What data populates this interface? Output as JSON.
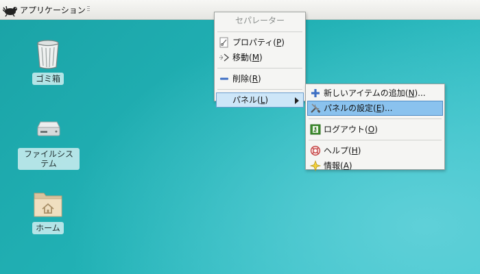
{
  "panel": {
    "app_menu_label": "アプリケーション",
    "logo_icon": "xfce-mouse-icon"
  },
  "desktop": {
    "icons": [
      {
        "label": "ゴミ箱",
        "icon": "trash-icon"
      },
      {
        "label": "ファイルシステム",
        "icon": "drive-icon"
      },
      {
        "label": "ホーム",
        "icon": "home-folder-icon"
      }
    ]
  },
  "context_menu": {
    "title": "セパレーター",
    "items": [
      {
        "label": "プロパティ(",
        "key": "P",
        "suffix": ")",
        "icon": "properties-icon"
      },
      {
        "label": "移動(",
        "key": "M",
        "suffix": ")",
        "icon": "move-icon"
      },
      {
        "label": "削除(",
        "key": "R",
        "suffix": ")",
        "icon": "remove-icon"
      },
      {
        "label": "パネル(",
        "key": "L",
        "suffix": ")",
        "icon": "",
        "submenu": true
      }
    ]
  },
  "panel_submenu": {
    "items": [
      {
        "label": "新しいアイテムの追加(",
        "key": "N",
        "suffix": ")...",
        "icon": "add-icon"
      },
      {
        "label": "パネルの設定(",
        "key": "E",
        "suffix": ")...",
        "icon": "preferences-icon"
      },
      {
        "label": "ログアウト(",
        "key": "O",
        "suffix": ")",
        "icon": "logout-icon"
      },
      {
        "label": "ヘルプ(",
        "key": "H",
        "suffix": ")",
        "icon": "help-icon"
      },
      {
        "label": "情報(",
        "key": "A",
        "suffix": ")",
        "icon": "about-icon"
      }
    ]
  },
  "colors": {
    "desktop_top": "#1aa3a6",
    "desktop_bottom": "#5fd0d8",
    "menu_bg": "#f5f5f3",
    "highlight": "#cde6f8"
  }
}
